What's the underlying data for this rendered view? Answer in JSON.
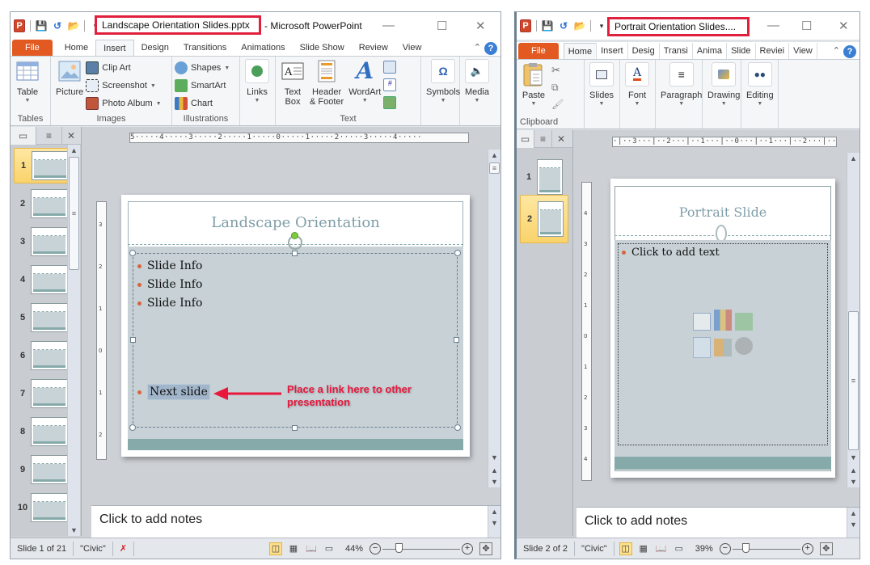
{
  "left_window": {
    "title_highlighted": "Landscape Orientation Slides.pptx",
    "title_rest": "- Microsoft PowerPoint",
    "app_icon": "P",
    "tabs": [
      "File",
      "Home",
      "Insert",
      "Design",
      "Transitions",
      "Animations",
      "Slide Show",
      "Review",
      "View"
    ],
    "active_tab": "Insert",
    "ribbon": {
      "tables": {
        "label": "Tables",
        "table": "Table"
      },
      "images": {
        "label": "Images",
        "picture": "Picture",
        "clip_art": "Clip Art",
        "screenshot": "Screenshot",
        "photo_album": "Photo Album"
      },
      "illustrations": {
        "label": "Illustrations",
        "shapes": "Shapes",
        "smartart": "SmartArt",
        "chart": "Chart"
      },
      "links": {
        "label": "Links"
      },
      "text": {
        "label": "Text",
        "text_box_1": "Text",
        "text_box_2": "Box",
        "header_1": "Header",
        "header_2": "& Footer",
        "wordart": "WordArt"
      },
      "symbols": {
        "label": "Symbols",
        "icon": "Ω"
      },
      "media": {
        "label": "Media"
      }
    },
    "thumbnails": [
      "1",
      "2",
      "3",
      "4",
      "5",
      "6",
      "7",
      "8",
      "9",
      "10"
    ],
    "selected_thumbnail": 1,
    "ruler_h": "5·····4·····3·····2·····1·····0·····1·····2·····3·····4·····",
    "slide": {
      "title": "Landscape Orientation",
      "bullets": [
        "Slide Info",
        "Slide Info",
        "Slide Info"
      ],
      "link_bullet": "Next slide",
      "annotation_line1": "Place a link here to other",
      "annotation_line2": "presentation",
      "annotation_color": "#e8173c"
    },
    "notes_placeholder": "Click to add notes",
    "status": {
      "slide": "Slide 1 of 21",
      "theme": "\"Civic\"",
      "zoom": "44%",
      "zoom_fraction": 0.44
    }
  },
  "right_window": {
    "title_highlighted": "Portrait Orientation Slides....",
    "app_icon": "P",
    "tabs": [
      "File",
      "Home",
      "Insert",
      "Desig",
      "Transi",
      "Anima",
      "Slide",
      "Reviei",
      "View"
    ],
    "active_tab": "Home",
    "ribbon": {
      "clipboard": {
        "label": "Clipboard",
        "paste": "Paste"
      },
      "slides": "Slides",
      "font": "Font",
      "paragraph": "Paragraph",
      "drawing": "Drawing",
      "editing": "Editing"
    },
    "thumbnails": [
      "1",
      "2"
    ],
    "selected_thumbnail": 2,
    "ruler_h": "·|··3···|··2···|··1···|··0···|··1···|··2···|··3···|·",
    "slide": {
      "title": "Portrait Slide",
      "placeholder": "Click to add text"
    },
    "notes_placeholder": "Click to add notes",
    "status": {
      "slide": "Slide 2 of 2",
      "theme": "\"Civic\"",
      "zoom": "39%",
      "zoom_fraction": 0.39
    }
  },
  "colors": {
    "file_tab": "#e25a22",
    "highlight_box": "#e0203c",
    "slide_title": "#7f9ea8",
    "bullet": "#d6643e",
    "slide_body": "#c7d1d6",
    "slide_footer": "#86aaa9"
  }
}
